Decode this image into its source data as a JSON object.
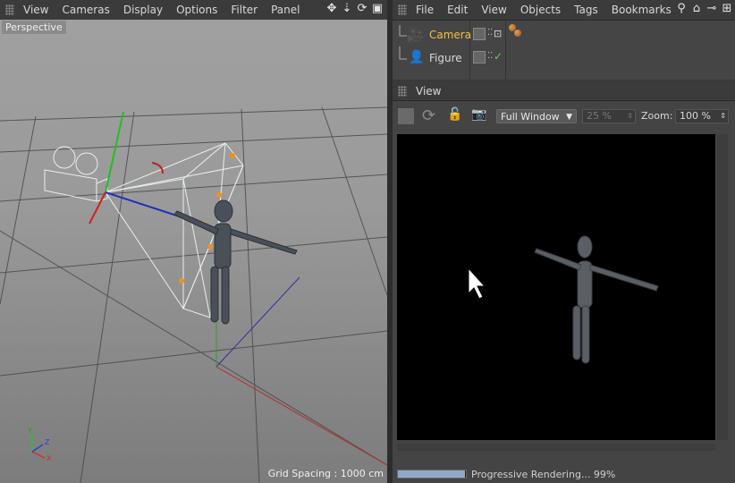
{
  "viewport": {
    "menu": [
      "View",
      "Cameras",
      "Display",
      "Options",
      "Filter",
      "Panel"
    ],
    "label": "Perspective",
    "grid_spacing": "Grid Spacing : 1000 cm",
    "axis": {
      "x": "X",
      "y": "Y",
      "z": "Z"
    }
  },
  "object_manager": {
    "menu": [
      "File",
      "Edit",
      "View",
      "Objects",
      "Tags",
      "Bookmarks"
    ],
    "objects": [
      {
        "name": "Camera",
        "color": "#f0c040",
        "icon": "camera-icon"
      },
      {
        "name": "Figure",
        "color": "#d8d8d8",
        "icon": "figure-icon"
      }
    ]
  },
  "view_panel": {
    "title": "View",
    "mode": "Full Window",
    "percent": "25 %",
    "zoom_label": "Zoom:",
    "zoom_value": "100 %",
    "status": "Progressive Rendering... 99%",
    "progress": 0.99
  },
  "colors": {
    "accent": "#f0c040",
    "progress": "#8fa8c8"
  }
}
